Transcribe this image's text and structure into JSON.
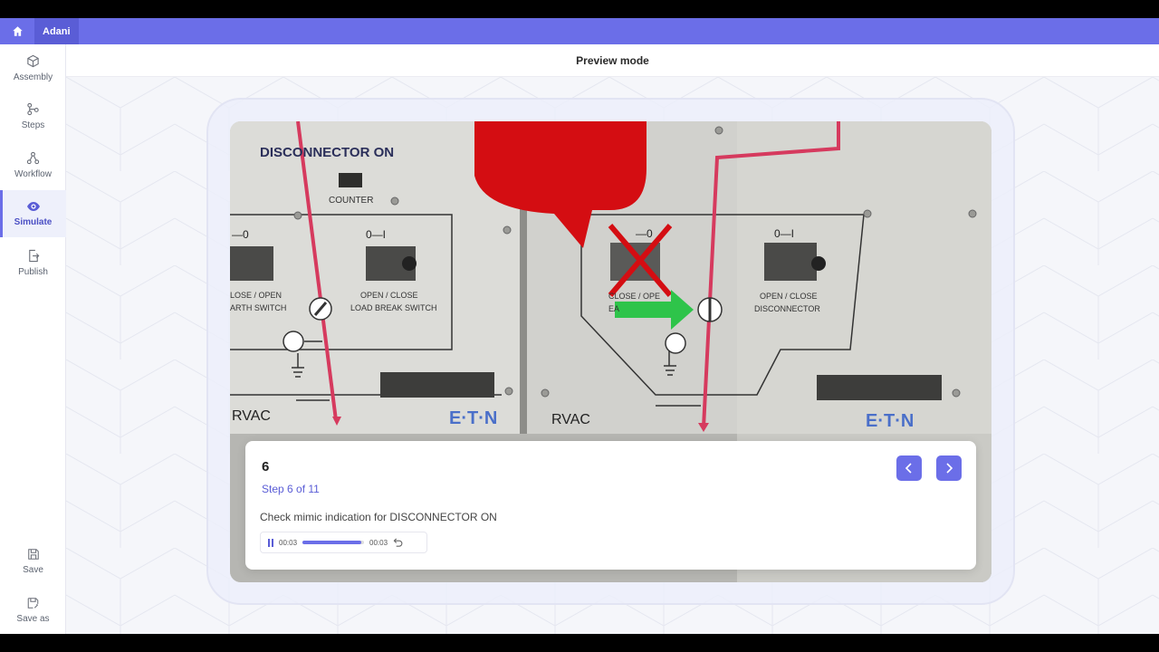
{
  "app": {
    "brand": "Adani"
  },
  "sidebar": {
    "items": [
      {
        "label": "Assembly"
      },
      {
        "label": "Steps"
      },
      {
        "label": "Workflow"
      },
      {
        "label": "Simulate"
      },
      {
        "label": "Publish"
      }
    ],
    "bottom": [
      {
        "label": "Save"
      },
      {
        "label": "Save as"
      }
    ]
  },
  "header": {
    "title": "Preview mode"
  },
  "scene": {
    "heading": "DISCONNECTOR ON",
    "counter": "COUNTER",
    "left_panel": {
      "switch_symbol": "0—I",
      "label_close_open": "OPEN / CLOSE",
      "label_load": "LOAD BREAK SWITCH",
      "earth_line1": "LOSE / OPEN",
      "earth_line2": "ARTH SWITCH",
      "left_symbol": "—0",
      "brand": "RVAC",
      "logo": "E·T·N"
    },
    "right_panel": {
      "switch_symbol": "0—I",
      "label_line1": "OPEN / CLOSE",
      "label_line2": "DISCONNECTOR",
      "partial_label": "CLOSE / OPE",
      "partial_label2": "EA",
      "crossed_symbol": "—0",
      "brand": "RVAC",
      "logo": "E·T·N"
    }
  },
  "step": {
    "number": "6",
    "progress_text": "Step 6 of 11",
    "description": "Check mimic indication for DISCONNECTOR ON"
  },
  "player": {
    "elapsed": "00:03",
    "duration": "00:03",
    "progress": 0.95
  },
  "colors": {
    "accent": "#6b6ee8",
    "mimic_red": "#d63a5e",
    "bubble_red": "#d40d12",
    "arrow_green": "#2ec44a"
  }
}
